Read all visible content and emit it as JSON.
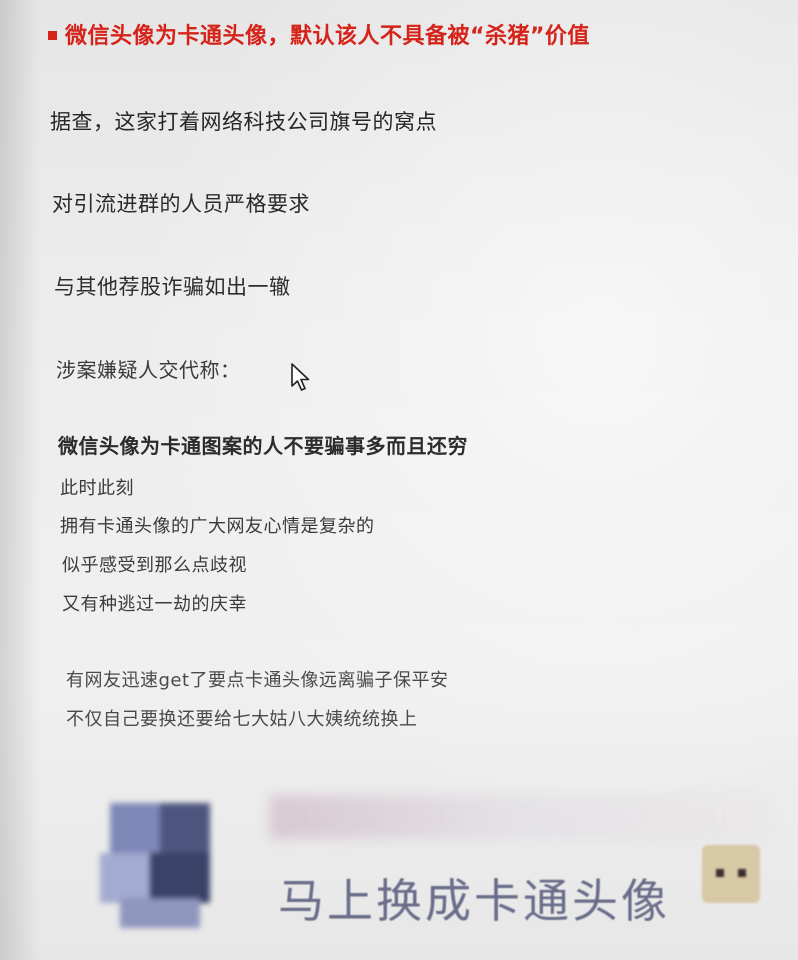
{
  "article": {
    "headline": "微信头像为卡通头像，默认该人不具备被“杀猪”价值",
    "paragraphs": [
      "据查，这家打着网络科技公司旗号的窝点",
      "对引流进群的人员严格要求",
      "与其他荐股诈骗如出一辙",
      "涉案嫌疑人交代称："
    ],
    "quote_bold": "微信头像为卡通图案的人不要骗事多而且还穷",
    "lines": [
      "此时此刻",
      "拥有卡通头像的广大网友心情是复杂的",
      "似乎感受到那么点歧视",
      "又有种逃过一劫的庆幸"
    ],
    "lines2": [
      "有网友迅速get了要点卡通头像远离骗子保平安",
      "不仅自己要换还要给七大姑八大姨统统换上"
    ],
    "banner_text": "马上换成卡通头像"
  },
  "colors": {
    "headline": "#d6231a",
    "banner_text": "#6a6e8a"
  },
  "icons": {
    "cursor": "mouse-pointer-icon",
    "bullet": "square-bullet-icon"
  }
}
